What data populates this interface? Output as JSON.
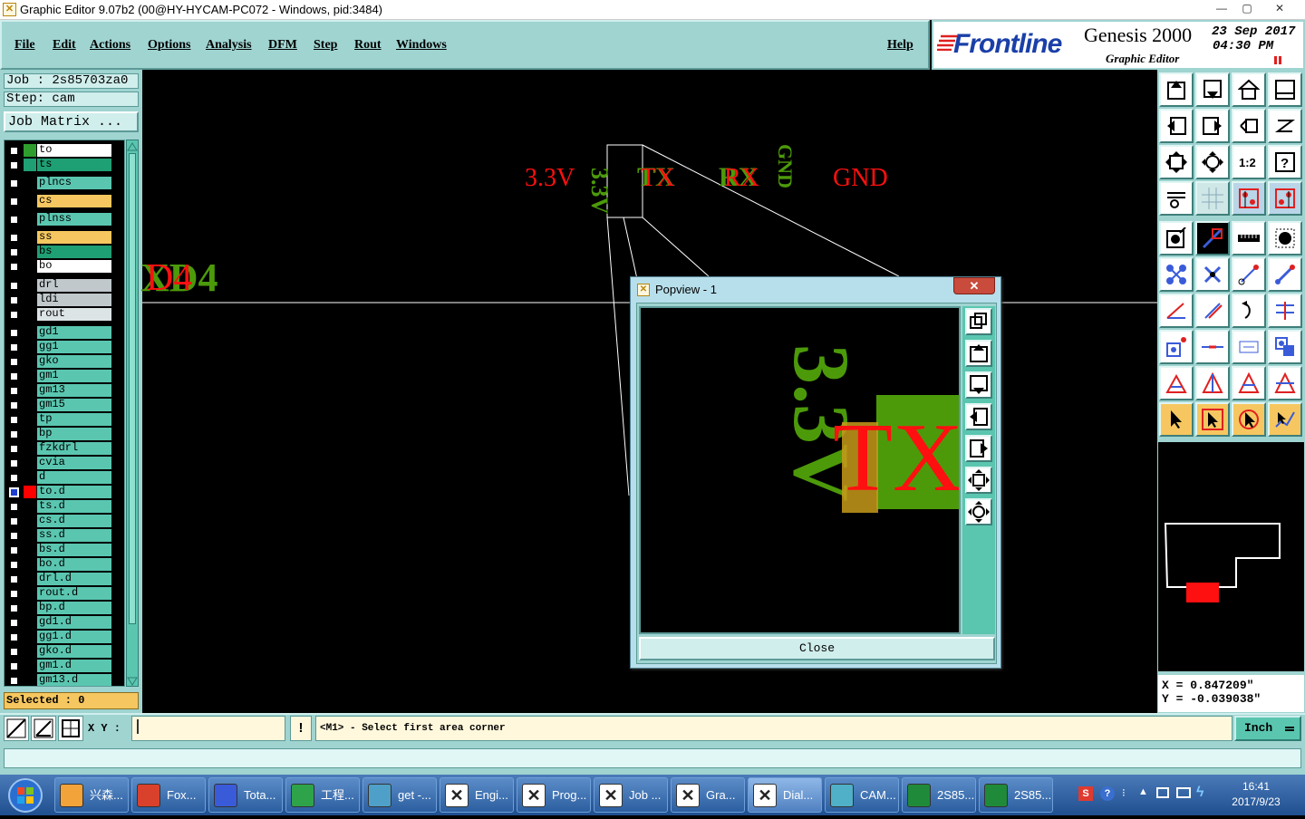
{
  "window": {
    "title": "Graphic Editor 9.07b2 (00@HY-HYCAM-PC072 - Windows, pid:3484)",
    "icon": "app-x-icon",
    "minimize": "—",
    "maximize": "▢",
    "close": "✕"
  },
  "menu": {
    "file": "File",
    "edit": "Edit",
    "actions": "Actions",
    "options": "Options",
    "analysis": "Analysis",
    "dfm": "DFM",
    "step": "Step",
    "rout": "Rout",
    "windows": "Windows",
    "help": "Help"
  },
  "logo": {
    "brand": "Frontline",
    "product": "Genesis 2000",
    "subtitle": "Graphic Editor",
    "date": "23 Sep 2017",
    "time": "04:30 PM"
  },
  "job": {
    "job_label": "Job : 2s85703za0",
    "step_label": "Step: cam",
    "job_matrix": "Job Matrix ..."
  },
  "layers": [
    {
      "name": "to",
      "color": "#ffffff",
      "swatch": "#2e9d2e"
    },
    {
      "name": "ts",
      "color": "#1f9f74",
      "swatch": "#1f9f74"
    },
    {
      "name": "plncs",
      "color": "#5ac6b0",
      "swatch": ""
    },
    {
      "name": "cs",
      "color": "#f6c760",
      "swatch": ""
    },
    {
      "name": "plnss",
      "color": "#5ac6b0",
      "swatch": ""
    },
    {
      "name": "ss",
      "color": "#f6c760",
      "swatch": ""
    },
    {
      "name": "bs",
      "color": "#1f9f74",
      "swatch": ""
    },
    {
      "name": "bo",
      "color": "#ffffff",
      "swatch": "",
      "mark": "✎"
    },
    {
      "name": "drl",
      "color": "#c0c8cc",
      "swatch": ""
    },
    {
      "name": "ldi",
      "color": "#c0c8cc",
      "swatch": ""
    },
    {
      "name": "rout",
      "color": "#dde4e6",
      "swatch": ""
    },
    {
      "name": "gd1",
      "color": "#5ac6b0",
      "swatch": "",
      "mark": "✎"
    },
    {
      "name": "gg1",
      "color": "#5ac6b0",
      "swatch": ""
    },
    {
      "name": "gko",
      "color": "#5ac6b0",
      "swatch": ""
    },
    {
      "name": "gm1",
      "color": "#5ac6b0",
      "swatch": ""
    },
    {
      "name": "gm13",
      "color": "#5ac6b0",
      "swatch": ""
    },
    {
      "name": "gm15",
      "color": "#5ac6b0",
      "swatch": ""
    },
    {
      "name": "tp",
      "color": "#5ac6b0",
      "swatch": ""
    },
    {
      "name": "bp",
      "color": "#5ac6b0",
      "swatch": ""
    },
    {
      "name": "fzkdrl",
      "color": "#5ac6b0",
      "swatch": ""
    },
    {
      "name": "cvia",
      "color": "#5ac6b0",
      "swatch": ""
    },
    {
      "name": "d",
      "color": "#5ac6b0",
      "swatch": ""
    },
    {
      "name": "to.d",
      "color": "#5ac6b0",
      "swatch": "#ff0000",
      "active": true,
      "mark": "▦"
    },
    {
      "name": "ts.d",
      "color": "#5ac6b0",
      "swatch": ""
    },
    {
      "name": "cs.d",
      "color": "#5ac6b0",
      "swatch": ""
    },
    {
      "name": "ss.d",
      "color": "#5ac6b0",
      "swatch": ""
    },
    {
      "name": "bs.d",
      "color": "#5ac6b0",
      "swatch": ""
    },
    {
      "name": "bo.d",
      "color": "#5ac6b0",
      "swatch": "",
      "mark": "✎"
    },
    {
      "name": "drl.d",
      "color": "#5ac6b0",
      "swatch": ""
    },
    {
      "name": "rout.d",
      "color": "#5ac6b0",
      "swatch": ""
    },
    {
      "name": "bp.d",
      "color": "#5ac6b0",
      "swatch": ""
    },
    {
      "name": "gd1.d",
      "color": "#5ac6b0",
      "swatch": "",
      "mark": "✎"
    },
    {
      "name": "gg1.d",
      "color": "#5ac6b0",
      "swatch": ""
    },
    {
      "name": "gko.d",
      "color": "#5ac6b0",
      "swatch": ""
    },
    {
      "name": "gm1.d",
      "color": "#5ac6b0",
      "swatch": ""
    },
    {
      "name": "gm13.d",
      "color": "#5ac6b0",
      "swatch": ""
    }
  ],
  "selected": "Selected : 0",
  "canvas": {
    "label_33v": "3.3V",
    "label_gnd": "GND",
    "label_tx": "TX",
    "label_rx": "RX",
    "label_d4": "D4",
    "label_d4_prefix": "X",
    "label_33v_rot": "3.3V",
    "label_gnd_rot": "GND"
  },
  "popview": {
    "title": "Popview - 1",
    "close_x": "✕",
    "close_button": "Close",
    "zoom_33v": "3.3V",
    "zoom_tx": "TX"
  },
  "coords": {
    "x": "X = 0.847209\"",
    "y": "Y = -0.039038\""
  },
  "bottom": {
    "xy_label": "X Y :",
    "xy_value": "",
    "exclaim": "!",
    "prompt": "<M1> - Select first area corner",
    "unit": "Inch"
  },
  "taskbar": {
    "items": [
      "兴森...",
      "Fox...",
      "Tota...",
      "工程...",
      "get -...",
      "Engi...",
      "Prog...",
      "Job ...",
      "Gra...",
      "Dial...",
      "CAM...",
      "2S85...",
      "2S85..."
    ],
    "time": "16:41",
    "date": "2017/9/23"
  },
  "colors": {
    "panel": "#9fd4d1",
    "accent_red": "#ff0000",
    "green": "#4c9a0a",
    "orange": "#f6c760"
  }
}
